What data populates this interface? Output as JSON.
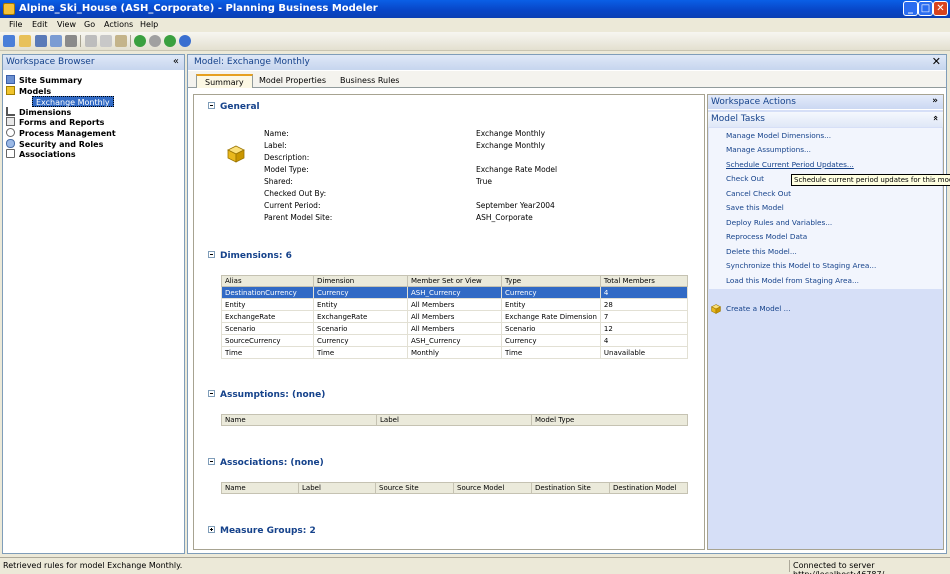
{
  "window": {
    "title": "Alpine_Ski_House (ASH_Corporate) - Planning Business Modeler",
    "minimize": "_",
    "maximize": "□",
    "close": "✕"
  },
  "menu": [
    "File",
    "Edit",
    "View",
    "Go",
    "Actions",
    "Help"
  ],
  "workspace_browser": {
    "title": "Workspace Browser",
    "collapse": "«",
    "items": [
      {
        "label": "Site Summary",
        "icon": "site-summary-icon"
      },
      {
        "label": "Models",
        "icon": "models-icon"
      },
      {
        "label": "Dimensions",
        "icon": "dimensions-icon"
      },
      {
        "label": "Forms and Reports",
        "icon": "forms-reports-icon"
      },
      {
        "label": "Process Management",
        "icon": "process-management-icon"
      },
      {
        "label": "Security and Roles",
        "icon": "security-roles-icon"
      },
      {
        "label": "Associations",
        "icon": "associations-icon"
      }
    ],
    "selected_child": "Exchange Monthly"
  },
  "main": {
    "title": "Model: Exchange Monthly",
    "close": "✕",
    "tabs": [
      "Summary",
      "Model Properties",
      "Business Rules"
    ],
    "active_tab": "Summary"
  },
  "general": {
    "heading": "General",
    "fields": [
      {
        "label": "Name:",
        "value": "Exchange Monthly"
      },
      {
        "label": "Label:",
        "value": "Exchange Monthly"
      },
      {
        "label": "Description:",
        "value": ""
      },
      {
        "label": "Model Type:",
        "value": "Exchange Rate Model"
      },
      {
        "label": "Shared:",
        "value": "True"
      },
      {
        "label": "Checked Out By:",
        "value": ""
      },
      {
        "label": "Current Period:",
        "value": "September Year2004"
      },
      {
        "label": "Parent Model Site:",
        "value": "ASH_Corporate"
      }
    ]
  },
  "dimensions": {
    "heading": "Dimensions: 6",
    "columns": [
      "Alias",
      "Dimension",
      "Member Set or View",
      "Type",
      "Total Members"
    ],
    "rows": [
      [
        "DestinationCurrency",
        "Currency",
        "ASH_Currency",
        "Currency",
        "4"
      ],
      [
        "Entity",
        "Entity",
        "All Members",
        "Entity",
        "28"
      ],
      [
        "ExchangeRate",
        "ExchangeRate",
        "All Members",
        "Exchange Rate Dimension",
        "7"
      ],
      [
        "Scenario",
        "Scenario",
        "All Members",
        "Scenario",
        "12"
      ],
      [
        "SourceCurrency",
        "Currency",
        "ASH_Currency",
        "Currency",
        "4"
      ],
      [
        "Time",
        "Time",
        "Monthly",
        "Time",
        "Unavailable"
      ]
    ],
    "selected_row": 0
  },
  "assumptions": {
    "heading": "Assumptions: (none)",
    "columns": [
      "Name",
      "Label",
      "Model Type"
    ]
  },
  "associations": {
    "heading": "Associations: (none)",
    "columns": [
      "Name",
      "Label",
      "Source Site",
      "Source Model",
      "Destination Site",
      "Destination Model"
    ]
  },
  "measure_groups": {
    "heading": "Measure Groups: 2"
  },
  "workspace_actions": {
    "title": "Workspace Actions",
    "expand": "»",
    "model_tasks_title": "Model Tasks",
    "collapse": "«",
    "tasks": [
      "Manage Model Dimensions...",
      "Manage Assumptions...",
      "Schedule Current Period Updates...",
      "Check Out",
      "Cancel Check Out",
      "Save this Model",
      "Deploy Rules and Variables...",
      "Reprocess Model Data",
      "Delete this Model...",
      "Synchronize this Model to Staging Area...",
      "Load this Model from Staging Area..."
    ],
    "create": "Create a Model ...",
    "tooltip": "Schedule current period updates for this model"
  },
  "status": {
    "left": "Retrieved rules for model Exchange Monthly.",
    "right": "Connected to server http://localhost:46787/."
  },
  "colors": {
    "accent": "#15428b",
    "selection": "#316ac5",
    "title_bar": "#0a5fe6"
  }
}
